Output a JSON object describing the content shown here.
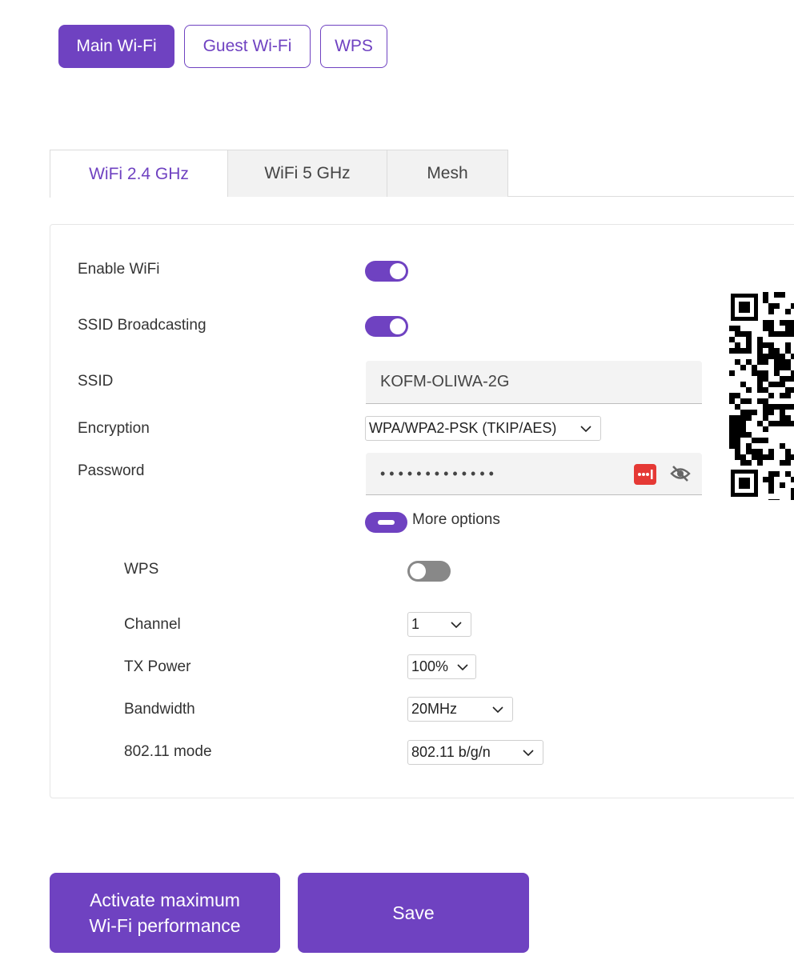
{
  "top_tabs": [
    {
      "label": "Main Wi-Fi",
      "active": true
    },
    {
      "label": "Guest Wi-Fi",
      "active": false
    },
    {
      "label": "WPS",
      "active": false
    }
  ],
  "band_tabs": [
    {
      "label": "WiFi 2.4 GHz",
      "active": true
    },
    {
      "label": "WiFi 5 GHz",
      "active": false
    },
    {
      "label": "Mesh",
      "active": false
    }
  ],
  "settings": {
    "enable_wifi": {
      "label": "Enable WiFi",
      "on": true
    },
    "ssid_broadcasting": {
      "label": "SSID Broadcasting",
      "on": true
    },
    "ssid": {
      "label": "SSID",
      "value": "KOFM-OLIWA-2G"
    },
    "encryption": {
      "label": "Encryption",
      "value": "WPA/WPA2-PSK (TKIP/AES)"
    },
    "password": {
      "label": "Password",
      "value": "•••••••••••••"
    },
    "more_options": {
      "label": "More options",
      "expanded": true
    },
    "wps": {
      "label": "WPS",
      "on": false
    },
    "channel": {
      "label": "Channel",
      "value": "1"
    },
    "tx_power": {
      "label": "TX Power",
      "value": "100%"
    },
    "bandwidth": {
      "label": "Bandwidth",
      "value": "20MHz"
    },
    "mode": {
      "label": "802.11 mode",
      "value": "802.11 b/g/n"
    }
  },
  "icons": {
    "password_manager": "password-manager-icon",
    "visibility": "eye-off-icon",
    "chevron": "chevron-down-icon",
    "qr": "qr-code"
  },
  "buttons": {
    "max_performance": "Activate maximum\nWi-Fi performance",
    "save": "Save"
  },
  "colors": {
    "accent": "#6f42c1",
    "toggle_off": "#888888",
    "password_manager_badge": "#e53935"
  }
}
